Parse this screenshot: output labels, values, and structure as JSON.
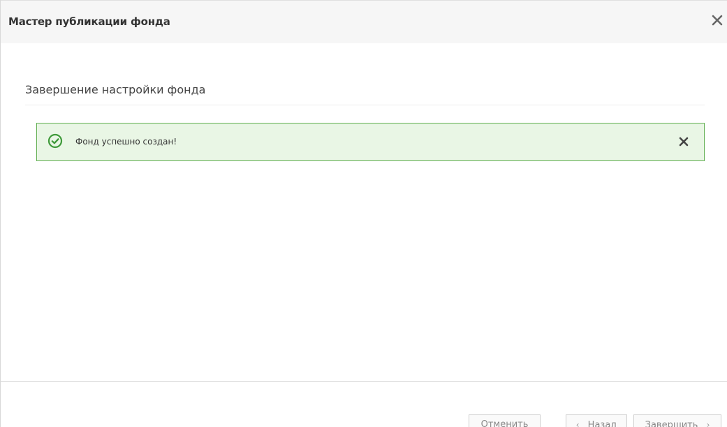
{
  "dialog": {
    "title": "Мастер публикации фонда",
    "close_icon": "close-icon"
  },
  "step": {
    "title": "Завершение настройки фонда"
  },
  "alert": {
    "icon": "check-circle-icon",
    "message": "Фонд успешно создан!",
    "close_icon": "close-icon",
    "colors": {
      "background": "#e9f6e5",
      "border": "#5fae4f",
      "icon": "#3f9a3a"
    }
  },
  "footer": {
    "cancel_label": "Отменить",
    "back_label": "Назад",
    "back_chevron": "‹",
    "finish_label": "Завершить",
    "finish_chevron": "›"
  }
}
